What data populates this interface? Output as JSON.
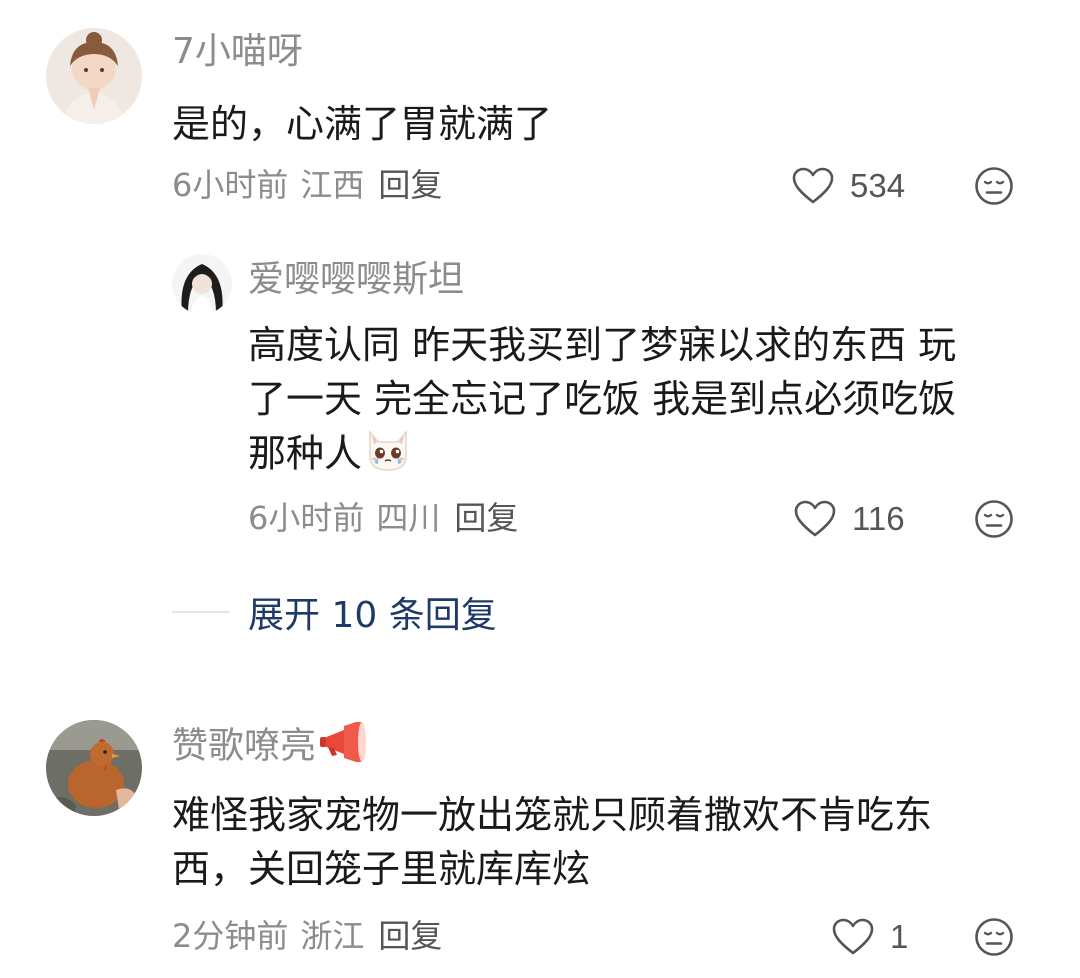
{
  "comments": [
    {
      "username": "7小喵呀",
      "content": "是的，心满了胃就满了",
      "time": "6小时前",
      "location": "江西",
      "reply": "回复",
      "likes": "534",
      "avatar_icon": "girl-praying-avatar"
    },
    {
      "username": "爱嘤嘤嘤斯坦",
      "content_lines": [
        "高度认同 昨天我买到了梦寐以求的东西 玩",
        "了一天 完全忘记了吃饭 我是到点必须吃饭",
        "那种人"
      ],
      "content_emoji": "crying-cat-emoji",
      "time": "6小时前",
      "location": "四川",
      "reply": "回复",
      "likes": "116",
      "avatar_icon": "anime-girl-avatar"
    },
    {
      "username": "赞歌嘹亮",
      "username_emoji": "megaphone-emoji",
      "content_lines": [
        "难怪我家宠物一放出笼就只顾着撒欢不肯吃东",
        "西，关回笼子里就库库炫"
      ],
      "time": "2分钟前",
      "location": "浙江",
      "reply": "回复",
      "likes": "1",
      "avatar_icon": "chicken-avatar"
    }
  ],
  "expand_replies": "展开 10 条回复",
  "colors": {
    "username": "#8c8c8c",
    "meta": "#8c8c8c",
    "expand_link": "#1f3a68",
    "text": "#1a1a1a"
  }
}
